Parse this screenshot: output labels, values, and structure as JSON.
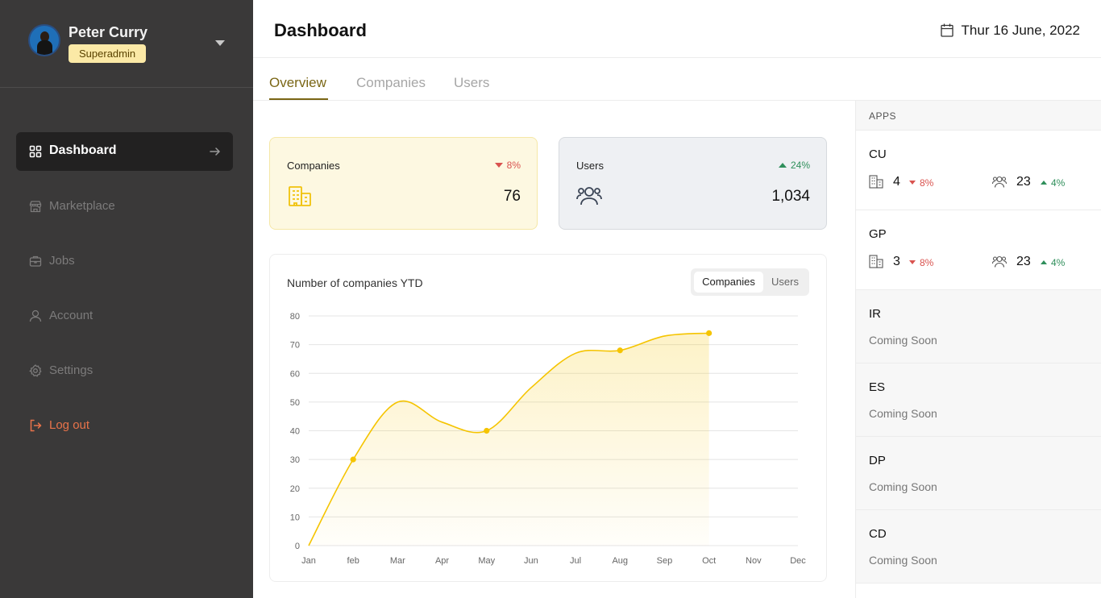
{
  "profile": {
    "name": "Peter Curry",
    "role": "Superadmin"
  },
  "nav": [
    {
      "label": "Dashboard",
      "icon": "grid-icon",
      "active": true
    },
    {
      "label": "Marketplace",
      "icon": "store-icon"
    },
    {
      "label": "Jobs",
      "icon": "briefcase-icon"
    },
    {
      "label": "Account",
      "icon": "user-icon"
    },
    {
      "label": "Settings",
      "icon": "gear-icon"
    },
    {
      "label": "Log out",
      "icon": "logout-icon"
    }
  ],
  "header": {
    "title": "Dashboard",
    "date": "Thur 16 June, 2022"
  },
  "tabs": [
    "Overview",
    "Companies",
    "Users"
  ],
  "stats": {
    "companies": {
      "label": "Companies",
      "trend": "8%",
      "direction": "down",
      "value": "76"
    },
    "users": {
      "label": "Users",
      "trend": "24%",
      "direction": "up",
      "value": "1,034"
    }
  },
  "colors": {
    "accent": "#f5c400",
    "sidebar": "#3a3939",
    "down": "#d9534f",
    "up": "#2f8f5b"
  },
  "chart": {
    "title": "Number of companies YTD",
    "toggle": {
      "on": "Companies",
      "off": "Users"
    }
  },
  "chart_data": {
    "type": "area",
    "x": [
      "Jan",
      "feb",
      "Mar",
      "Apr",
      "May",
      "Jun",
      "Jul",
      "Aug",
      "Sep",
      "Oct",
      "Nov",
      "Dec"
    ],
    "values": [
      0,
      30,
      50,
      43,
      40,
      55,
      67,
      68,
      73,
      74
    ],
    "marked_points": [
      1,
      4,
      7,
      9
    ],
    "ylim": [
      0,
      80
    ],
    "yticks": [
      0,
      10,
      20,
      30,
      40,
      50,
      60,
      70,
      80
    ],
    "grid": true,
    "color": "#f5c400"
  },
  "apps": {
    "title": "APPS",
    "items": [
      {
        "name": "CU",
        "companies": "4",
        "companies_trend": "8%",
        "users": "23",
        "users_trend": "4%"
      },
      {
        "name": "GP",
        "companies": "3",
        "companies_trend": "8%",
        "users": "23",
        "users_trend": "4%"
      },
      {
        "name": "IR",
        "status": "Coming Soon"
      },
      {
        "name": "ES",
        "status": "Coming Soon"
      },
      {
        "name": "DP",
        "status": "Coming Soon"
      },
      {
        "name": "CD",
        "status": "Coming Soon"
      }
    ]
  }
}
